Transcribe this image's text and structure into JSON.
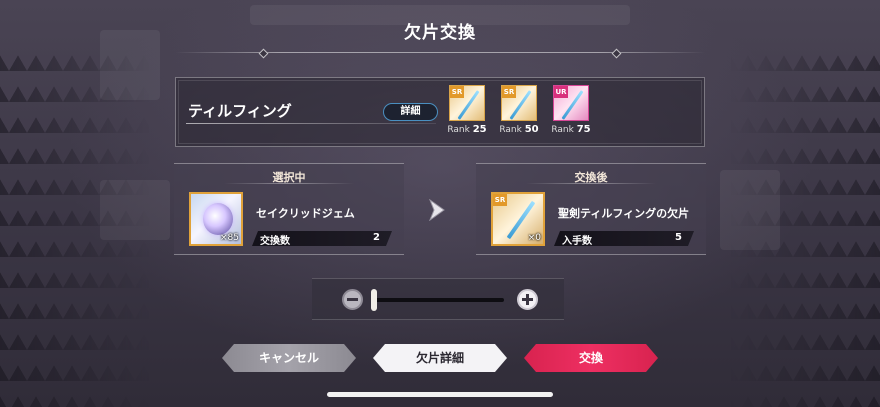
{
  "title": "欠片交換",
  "weapon": {
    "name": "ティルフィング",
    "detail_label": "詳細",
    "ranks": [
      {
        "rarity": "SR",
        "rank_label": "Rank",
        "rank_value": "25"
      },
      {
        "rarity": "SR",
        "rank_label": "Rank",
        "rank_value": "50"
      },
      {
        "rarity": "UR",
        "rank_label": "Rank",
        "rank_value": "75"
      }
    ]
  },
  "selected": {
    "header": "選択中",
    "item_name": "セイクリッドジェム",
    "item_count": "×85",
    "stat_label": "交換数",
    "stat_value": "2"
  },
  "result": {
    "header": "交換後",
    "item_badge": "SR",
    "item_name": "聖剣ティルフィングの欠片",
    "item_count": "×0",
    "stat_label": "入手数",
    "stat_value": "5"
  },
  "slider": {
    "value_fraction": 0.0
  },
  "buttons": {
    "cancel": "キャンセル",
    "detail": "欠片詳細",
    "exchange": "交換"
  },
  "colors": {
    "accent_exchange": "#e82a5c",
    "sr_badge": "#e2992a",
    "ur_badge": "#d8307c",
    "detail_border": "#4a8fc0"
  },
  "icons": {
    "arrow": "chevron-right-icon",
    "minus": "minus-icon",
    "plus": "plus-icon"
  }
}
